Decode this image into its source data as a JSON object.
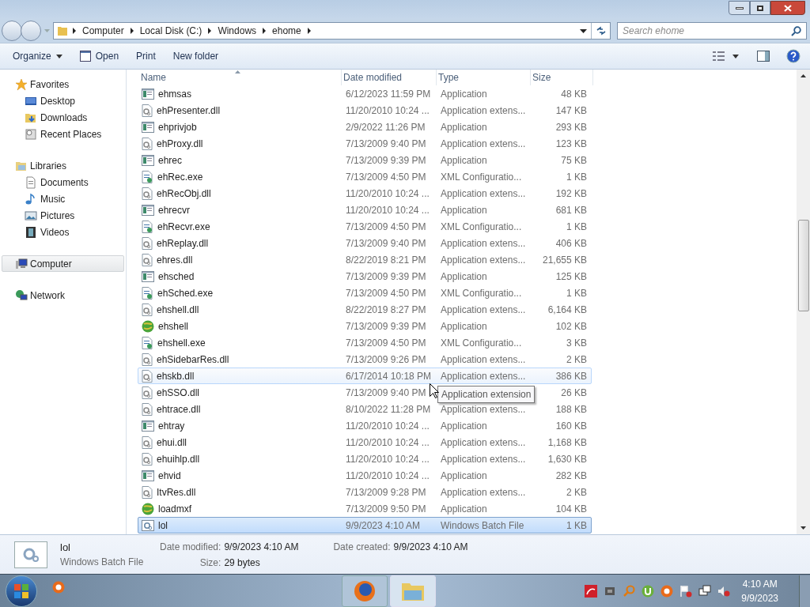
{
  "address": {
    "crumbs": [
      "Computer",
      "Local Disk (C:)",
      "Windows",
      "ehome"
    ]
  },
  "search": {
    "placeholder": "Search ehome"
  },
  "toolbar": {
    "buttons": [
      "Organize",
      "Open",
      "Print",
      "New folder"
    ]
  },
  "sidebar": {
    "groups": [
      {
        "label": "Favorites",
        "kind": "star",
        "selected": false,
        "children": [
          {
            "label": "Desktop",
            "kind": "desktop",
            "selected": false
          },
          {
            "label": "Downloads",
            "kind": "downloads",
            "selected": false
          },
          {
            "label": "Recent Places",
            "kind": "recent",
            "selected": false
          }
        ]
      },
      {
        "label": "Libraries",
        "kind": "library",
        "selected": false,
        "children": [
          {
            "label": "Documents",
            "kind": "doc",
            "selected": false
          },
          {
            "label": "Music",
            "kind": "music",
            "selected": false
          },
          {
            "label": "Pictures",
            "kind": "pictures",
            "selected": false
          },
          {
            "label": "Videos",
            "kind": "videos",
            "selected": false
          }
        ]
      },
      {
        "label": "Computer",
        "kind": "computer",
        "selected": true
      },
      {
        "label": "Network",
        "kind": "network",
        "selected": false
      }
    ]
  },
  "table": {
    "columns": [
      "Name",
      "Date modified",
      "Type",
      "Size"
    ],
    "rows": [
      {
        "name": "ehmsas",
        "date": "6/12/2023 11:59 PM",
        "type": "Application",
        "size": "48 KB",
        "kind": "app",
        "selected": false,
        "hovered": false
      },
      {
        "name": "ehPresenter.dll",
        "date": "11/20/2010 10:24 ...",
        "type": "Application extens...",
        "size": "147 KB",
        "kind": "dll",
        "selected": false,
        "hovered": false
      },
      {
        "name": "ehprivjob",
        "date": "2/9/2022 11:26 PM",
        "type": "Application",
        "size": "293 KB",
        "kind": "app",
        "selected": false,
        "hovered": false
      },
      {
        "name": "ehProxy.dll",
        "date": "7/13/2009 9:40 PM",
        "type": "Application extens...",
        "size": "123 KB",
        "kind": "dll",
        "selected": false,
        "hovered": false
      },
      {
        "name": "ehrec",
        "date": "7/13/2009 9:39 PM",
        "type": "Application",
        "size": "75 KB",
        "kind": "app",
        "selected": false,
        "hovered": false
      },
      {
        "name": "ehRec.exe",
        "date": "7/13/2009 4:50 PM",
        "type": "XML Configuratio...",
        "size": "1 KB",
        "kind": "xml",
        "selected": false,
        "hovered": false
      },
      {
        "name": "ehRecObj.dll",
        "date": "11/20/2010 10:24 ...",
        "type": "Application extens...",
        "size": "192 KB",
        "kind": "dll",
        "selected": false,
        "hovered": false
      },
      {
        "name": "ehrecvr",
        "date": "11/20/2010 10:24 ...",
        "type": "Application",
        "size": "681 KB",
        "kind": "app",
        "selected": false,
        "hovered": false
      },
      {
        "name": "ehRecvr.exe",
        "date": "7/13/2009 4:50 PM",
        "type": "XML Configuratio...",
        "size": "1 KB",
        "kind": "xml",
        "selected": false,
        "hovered": false
      },
      {
        "name": "ehReplay.dll",
        "date": "7/13/2009 9:40 PM",
        "type": "Application extens...",
        "size": "406 KB",
        "kind": "dll",
        "selected": false,
        "hovered": false
      },
      {
        "name": "ehres.dll",
        "date": "8/22/2019 8:21 PM",
        "type": "Application extens...",
        "size": "21,655 KB",
        "kind": "dll",
        "selected": false,
        "hovered": false
      },
      {
        "name": "ehsched",
        "date": "7/13/2009 9:39 PM",
        "type": "Application",
        "size": "125 KB",
        "kind": "app",
        "selected": false,
        "hovered": false
      },
      {
        "name": "ehSched.exe",
        "date": "7/13/2009 4:50 PM",
        "type": "XML Configuratio...",
        "size": "1 KB",
        "kind": "xml",
        "selected": false,
        "hovered": false
      },
      {
        "name": "ehshell.dll",
        "date": "8/22/2019 8:27 PM",
        "type": "Application extens...",
        "size": "6,164 KB",
        "kind": "dll",
        "selected": false,
        "hovered": false
      },
      {
        "name": "ehshell",
        "date": "7/13/2009 9:39 PM",
        "type": "Application",
        "size": "102 KB",
        "kind": "globe",
        "selected": false,
        "hovered": false
      },
      {
        "name": "ehshell.exe",
        "date": "7/13/2009 4:50 PM",
        "type": "XML Configuratio...",
        "size": "3 KB",
        "kind": "xml",
        "selected": false,
        "hovered": false
      },
      {
        "name": "ehSidebarRes.dll",
        "date": "7/13/2009 9:26 PM",
        "type": "Application extens...",
        "size": "2 KB",
        "kind": "dll",
        "selected": false,
        "hovered": false
      },
      {
        "name": "ehskb.dll",
        "date": "6/17/2014 10:18 PM",
        "type": "Application extens...",
        "size": "386 KB",
        "kind": "dll",
        "selected": false,
        "hovered": true
      },
      {
        "name": "ehSSO.dll",
        "date": "7/13/2009 9:40 PM",
        "size": "26 KB",
        "tooltip": "Application extension",
        "kind": "dll",
        "selected": false,
        "hovered": false
      },
      {
        "name": "ehtrace.dll",
        "date": "8/10/2022 11:28 PM",
        "type": "Application extens...",
        "size": "188 KB",
        "kind": "dll",
        "selected": false,
        "hovered": false
      },
      {
        "name": "ehtray",
        "date": "11/20/2010 10:24 ...",
        "type": "Application",
        "size": "160 KB",
        "kind": "app",
        "selected": false,
        "hovered": false
      },
      {
        "name": "ehui.dll",
        "date": "11/20/2010 10:24 ...",
        "type": "Application extens...",
        "size": "1,168 KB",
        "kind": "dll",
        "selected": false,
        "hovered": false
      },
      {
        "name": "ehuihlp.dll",
        "date": "11/20/2010 10:24 ...",
        "type": "Application extens...",
        "size": "1,630 KB",
        "kind": "dll",
        "selected": false,
        "hovered": false
      },
      {
        "name": "ehvid",
        "date": "11/20/2010 10:24 ...",
        "type": "Application",
        "size": "282 KB",
        "kind": "app",
        "selected": false,
        "hovered": false
      },
      {
        "name": "ItvRes.dll",
        "date": "7/13/2009 9:28 PM",
        "type": "Application extens...",
        "size": "2 KB",
        "kind": "dll",
        "selected": false,
        "hovered": false
      },
      {
        "name": "loadmxf",
        "date": "7/13/2009 9:50 PM",
        "type": "Application",
        "size": "104 KB",
        "kind": "globe",
        "selected": false,
        "hovered": false
      },
      {
        "name": "lol",
        "date": "9/9/2023 4:10 AM",
        "type": "Windows Batch File",
        "size": "1 KB",
        "kind": "bat",
        "selected": true,
        "hovered": false
      }
    ]
  },
  "details": {
    "name": "lol",
    "type": "Windows Batch File",
    "fields": [
      {
        "label": "Date modified:",
        "value": "9/9/2023 4:10 AM"
      },
      {
        "label": "Size:",
        "value": "29 bytes"
      },
      {
        "label": "Date created:",
        "value": "9/9/2023 4:10 AM"
      }
    ]
  },
  "taskbar": {
    "clock": {
      "time": "4:10 AM",
      "date": "9/9/2023"
    }
  }
}
